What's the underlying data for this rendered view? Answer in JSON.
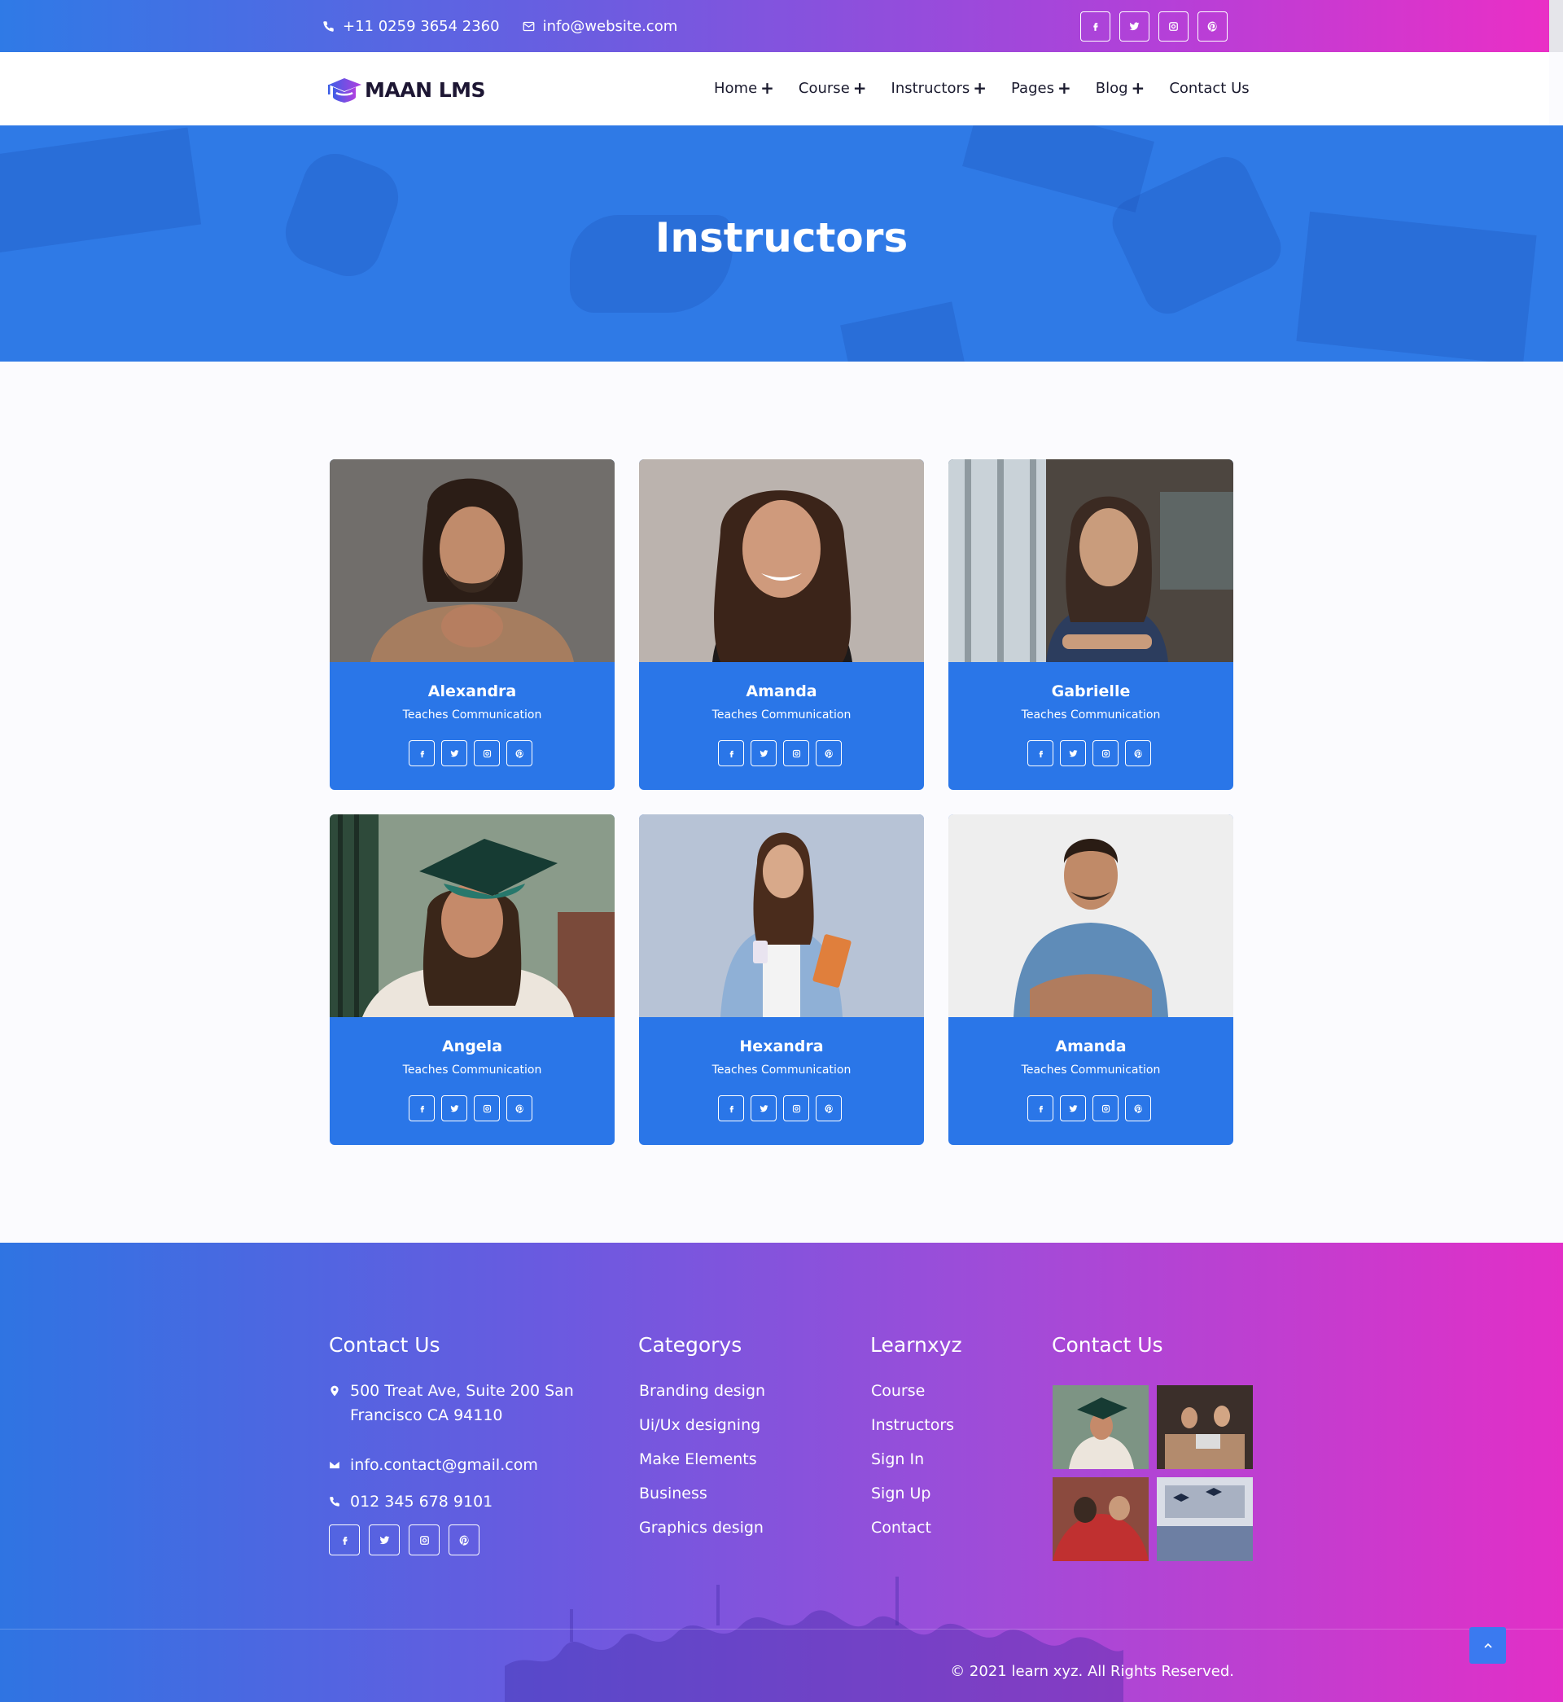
{
  "topbar": {
    "phone": "+11 0259 3654 2360",
    "email": "info@website.com",
    "social": [
      "facebook-icon",
      "twitter-icon",
      "instagram-icon",
      "pinterest-icon"
    ]
  },
  "brand": {
    "logo_text": "MAAN LMS"
  },
  "nav": {
    "items": [
      {
        "label": "Home",
        "plus": "+"
      },
      {
        "label": "Course",
        "plus": "+"
      },
      {
        "label": "Instructors",
        "plus": "+"
      },
      {
        "label": "Pages",
        "plus": "+"
      },
      {
        "label": "Blog",
        "plus": "+"
      },
      {
        "label": "Contact Us",
        "plus": ""
      }
    ]
  },
  "hero": {
    "title": "Instructors"
  },
  "instructors": [
    {
      "name": "Alexandra",
      "role": "Teaches Communication"
    },
    {
      "name": "Amanda",
      "role": "Teaches Communication"
    },
    {
      "name": "Gabrielle",
      "role": "Teaches Communication"
    },
    {
      "name": "Angela",
      "role": "Teaches Communication"
    },
    {
      "name": "Hexandra",
      "role": "Teaches Communication"
    },
    {
      "name": "Amanda",
      "role": "Teaches Communication"
    }
  ],
  "footer": {
    "contact": {
      "title": "Contact Us",
      "address_line1": "500 Treat Ave, Suite 200 San",
      "address_line2": "Francisco CA 94110",
      "email": "info.contact@gmail.com",
      "phone": "012 345 678 9101"
    },
    "categories": {
      "title": "Categorys",
      "items": [
        "Branding design",
        "Ui/Ux designing",
        "Make Elements",
        "Business",
        "Graphics design"
      ]
    },
    "learn": {
      "title": "Learnxyz",
      "items": [
        "Course",
        "Instructors",
        "Sign In",
        "Sign Up",
        "Contact"
      ]
    },
    "gallery": {
      "title": "Contact Us"
    },
    "copyright": "© 2021 learn xyz. All Rights Reserved."
  },
  "colors": {
    "primary_blue": "#2a76e8",
    "gradient_start": "#2f7ae6",
    "gradient_end": "#ea2fc6",
    "logo_purple": "#7b3fe4"
  }
}
